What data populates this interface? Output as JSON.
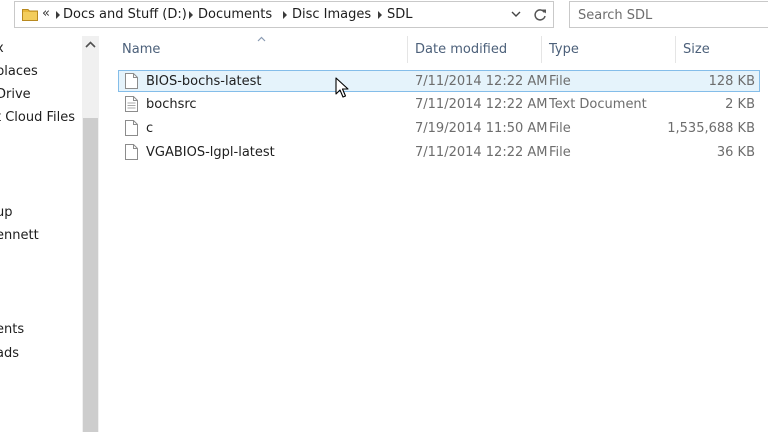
{
  "address_bar": {
    "overflow": "«",
    "breadcrumbs": [
      {
        "label": "Docs and Stuff (D:)"
      },
      {
        "label": "Documents"
      },
      {
        "label": "Disc Images"
      },
      {
        "label": "SDL"
      }
    ]
  },
  "search": {
    "placeholder": "Search SDL"
  },
  "nav_pane": {
    "items": [
      {
        "label": "x"
      },
      {
        "label": "places"
      },
      {
        "label": "Drive"
      },
      {
        "label": "t Cloud Files"
      },
      {
        "label": "up"
      },
      {
        "label": "ennett"
      },
      {
        "label": "ents"
      },
      {
        "label": "ads"
      }
    ]
  },
  "columns": {
    "name": "Name",
    "date_modified": "Date modified",
    "type": "Type",
    "size": "Size"
  },
  "files": [
    {
      "name": "BIOS-bochs-latest",
      "date_modified": "7/11/2014 12:22 AM",
      "type": "File",
      "size": "128 KB",
      "selected": true
    },
    {
      "name": "bochsrc",
      "date_modified": "7/11/2014 12:22 AM",
      "type": "Text Document",
      "size": "2 KB",
      "selected": false
    },
    {
      "name": "c",
      "date_modified": "7/19/2014 11:50 AM",
      "type": "File",
      "size": "1,535,688 KB",
      "selected": false
    },
    {
      "name": "VGABIOS-lgpl-latest",
      "date_modified": "7/11/2014 12:22 AM",
      "type": "File",
      "size": "36 KB",
      "selected": false
    }
  ],
  "icons": {
    "folder": "folder-icon",
    "refresh": "refresh-icon",
    "file": "file-icon",
    "cursor": "mouse-cursor-icon"
  },
  "colors": {
    "selection_fill": "#e5f3fb",
    "selection_border": "#84bde9",
    "column_header_text": "#4c607a",
    "folder_yellow": "#e8b83a"
  }
}
